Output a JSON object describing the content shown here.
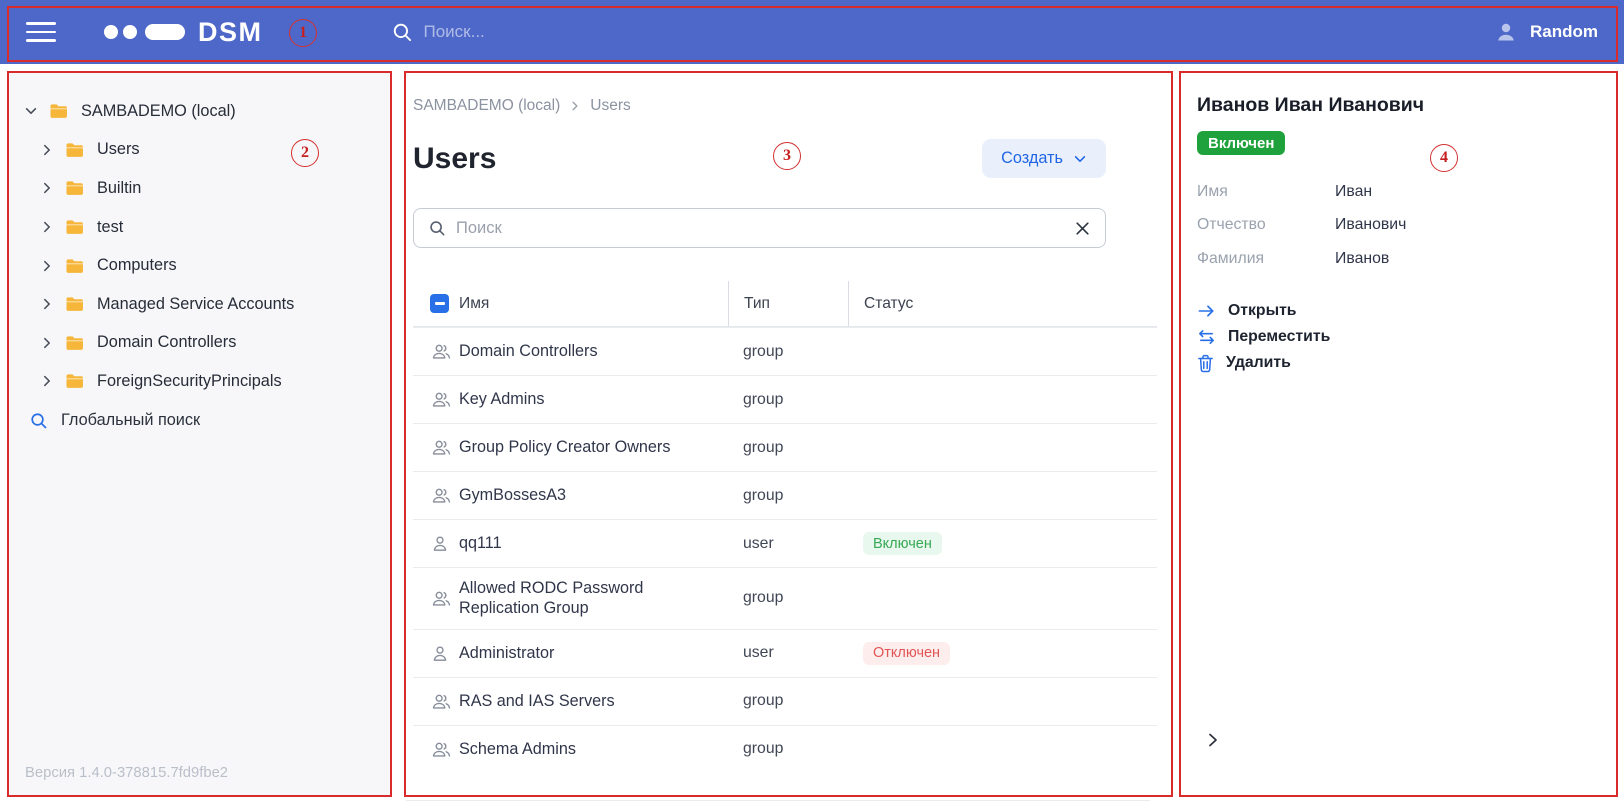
{
  "annotations": {
    "color": "#d92b2b",
    "labels": [
      "1",
      "2",
      "3",
      "4"
    ]
  },
  "header": {
    "logo_text": "DSM",
    "search_placeholder": "Поиск...",
    "user_name": "Random"
  },
  "sidebar": {
    "tree": [
      {
        "label": "SAMBADEMO (local)",
        "expanded": true
      },
      {
        "label": "Users",
        "expanded": false
      },
      {
        "label": "Builtin",
        "expanded": false
      },
      {
        "label": "test",
        "expanded": false
      },
      {
        "label": "Computers",
        "expanded": false
      },
      {
        "label": "Managed Service Accounts",
        "expanded": false
      },
      {
        "label": "Domain Controllers",
        "expanded": false
      },
      {
        "label": "ForeignSecurityPrincipals",
        "expanded": false
      }
    ],
    "global_search_label": "Глобальный поиск",
    "version": "Версия 1.4.0-378815.7fd9fbe2"
  },
  "main": {
    "breadcrumb": {
      "root": "SAMBADEMO (local)",
      "current": "Users"
    },
    "title": "Users",
    "create_button_label": "Создать",
    "search_placeholder": "Поиск",
    "table": {
      "columns": {
        "name": "Имя",
        "type": "Тип",
        "status": "Статус"
      },
      "rows": [
        {
          "name": "Domain Controllers",
          "type": "group",
          "status": ""
        },
        {
          "name": "Key Admins",
          "type": "group",
          "status": ""
        },
        {
          "name": "Group Policy Creator Owners",
          "type": "group",
          "status": ""
        },
        {
          "name": "GymBossesA3",
          "type": "group",
          "status": ""
        },
        {
          "name": "qq111",
          "type": "user",
          "status": "Включен"
        },
        {
          "name": "Allowed RODC Password Replication Group",
          "type": "group",
          "status": ""
        },
        {
          "name": "Administrator",
          "type": "user",
          "status": "Отключен"
        },
        {
          "name": "RAS and IAS Servers",
          "type": "group",
          "status": ""
        },
        {
          "name": "Schema Admins",
          "type": "group",
          "status": ""
        }
      ]
    }
  },
  "details": {
    "title": "Иванов Иван Иванович",
    "status_badge": "Включен",
    "fields": [
      {
        "label": "Имя",
        "value": "Иван"
      },
      {
        "label": "Отчество",
        "value": "Иванович"
      },
      {
        "label": "Фамилия",
        "value": "Иванов"
      }
    ],
    "actions": [
      {
        "icon": "arrow-right-icon",
        "label": "Открыть"
      },
      {
        "icon": "swap-icon",
        "label": "Переместить"
      },
      {
        "icon": "trash-icon",
        "label": "Удалить"
      }
    ]
  },
  "colors": {
    "header_blue": "#4e68c9",
    "accent_blue": "#2970e8",
    "create_button_bg": "#e9f0fb",
    "create_button_text": "#2066e4",
    "status_on_solid": "#1fa23c",
    "status_on_bg": "#e9f8ee",
    "status_on_text": "#36a854",
    "status_off_bg": "#fdeeed",
    "status_off_text": "#e25555",
    "annotation_red": "#d92b2b",
    "folder_yellow": "#f5b63a",
    "sidebar_bg": "#f7f7f9"
  }
}
